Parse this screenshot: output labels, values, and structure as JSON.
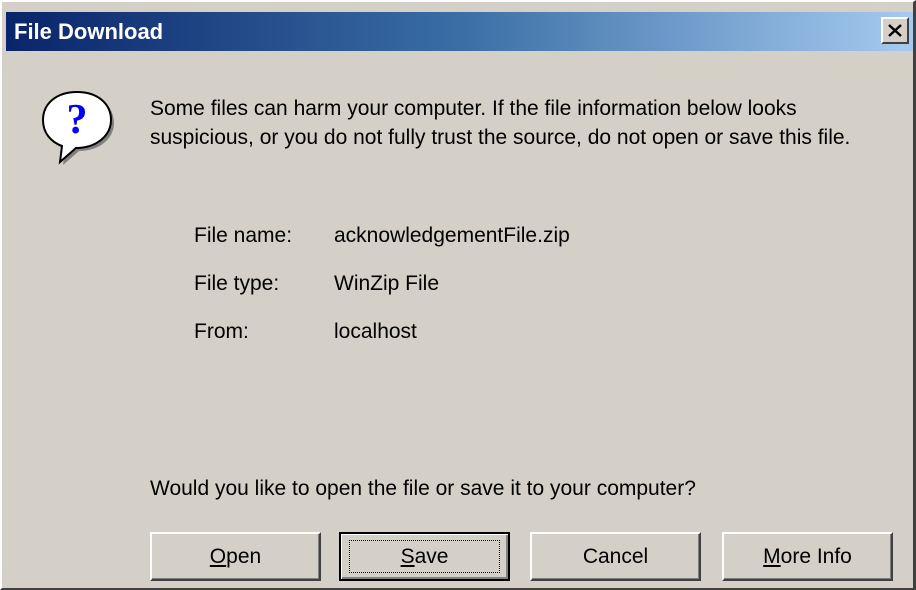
{
  "window": {
    "title": "File Download",
    "close_glyph": "✕"
  },
  "dialog": {
    "icon": "question-mark-icon",
    "warning_text": "Some files can harm your computer. If the file information below looks suspicious, or you do not fully trust the source, do not open or save this file.",
    "file_info": [
      {
        "label": "File name:",
        "value": "acknowledgementFile.zip"
      },
      {
        "label": "File type:",
        "value": "WinZip File"
      },
      {
        "label": "From:",
        "value": "localhost"
      }
    ],
    "question": "Would you like to open the file or save it to your computer?"
  },
  "buttons": {
    "open": {
      "accel": "O",
      "rest": "pen"
    },
    "save": {
      "accel": "S",
      "rest": "ave"
    },
    "cancel": {
      "label": "Cancel"
    },
    "more_info": {
      "accel": "M",
      "rest": "ore Info"
    }
  },
  "colors": {
    "dialog_bg": "#d4d0c8",
    "titlebar_start": "#0a246a",
    "titlebar_end": "#a6caf0",
    "icon_blue": "#0000ff"
  }
}
